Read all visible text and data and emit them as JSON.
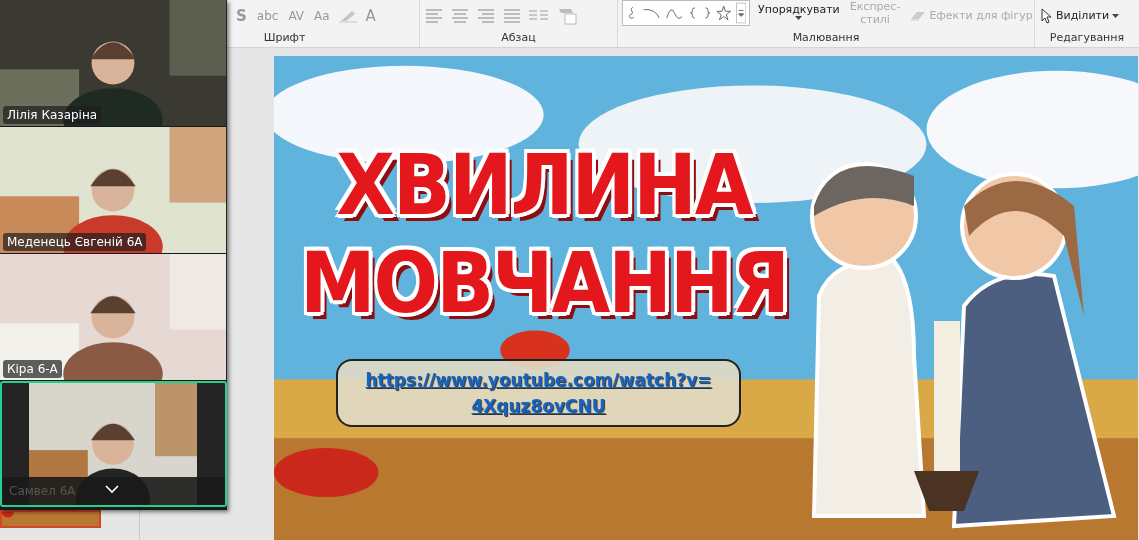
{
  "ribbon": {
    "font_tools": [
      {
        "label": "S"
      },
      {
        "label": "abc"
      },
      {
        "label": "AV"
      },
      {
        "label": "Aa"
      },
      {
        "label": "A"
      }
    ],
    "arrange": {
      "label": "Упорядкувати",
      "disabled": false
    },
    "quick_styles": {
      "lines": [
        "Експрес-",
        "стилі"
      ],
      "disabled": true
    },
    "shape_effects": {
      "label": "Ефекти для фігур",
      "disabled": true
    },
    "select": {
      "label": "Виділити",
      "disabled": false
    },
    "groups": [
      {
        "label": "Шрифт"
      },
      {
        "label": "Абзац"
      },
      {
        "label": "Малювання"
      },
      {
        "label": "Редагування"
      }
    ]
  },
  "slide": {
    "title_lines": [
      "ХВИЛИНА",
      "МОВЧАННЯ"
    ],
    "link_lines": [
      "https://www.youtube.com/watch?v=",
      "4Xquz8ovCNU"
    ]
  },
  "video_call": {
    "tiles": [
      {
        "name": "Лілія Казаріна",
        "speaking": false,
        "hovered": false
      },
      {
        "name": "Меденець Євгеній 6А",
        "speaking": false,
        "hovered": false
      },
      {
        "name": "Кіра 6-А",
        "speaking": false,
        "hovered": false
      },
      {
        "name": "Самвел 6А",
        "speaking": true,
        "hovered": true
      }
    ]
  }
}
